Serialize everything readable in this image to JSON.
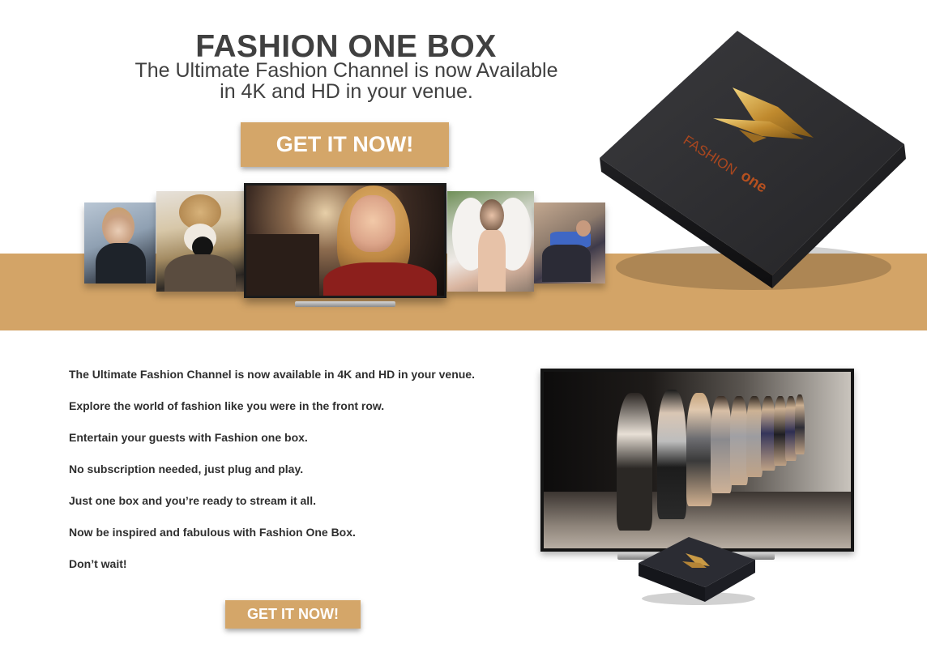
{
  "hero": {
    "title": "FASHION ONE BOX",
    "subtitle_line1": "The Ultimate Fashion Channel is now Available",
    "subtitle_line2": "in 4K and HD in your venue.",
    "cta_label": "GET IT NOW!"
  },
  "product_box": {
    "brand_text_left": "FASHION",
    "brand_text_right": "one",
    "accent_color": "#d4a669"
  },
  "features": [
    "The Ultimate Fashion Channel is now available in 4K and HD in your venue.",
    "Explore the world of fashion like you were in the front row.",
    "Entertain your guests with Fashion one box.",
    "No subscription needed, just plug and play.",
    "Just one box and you’re ready to stream it all.",
    "Now be inspired and fabulous with Fashion One Box.",
    "Don’t wait!"
  ],
  "bottom": {
    "cta_label": "GET IT NOW!"
  },
  "colors": {
    "band": "#d3a467",
    "button": "#d4a669",
    "heading": "#404040"
  }
}
